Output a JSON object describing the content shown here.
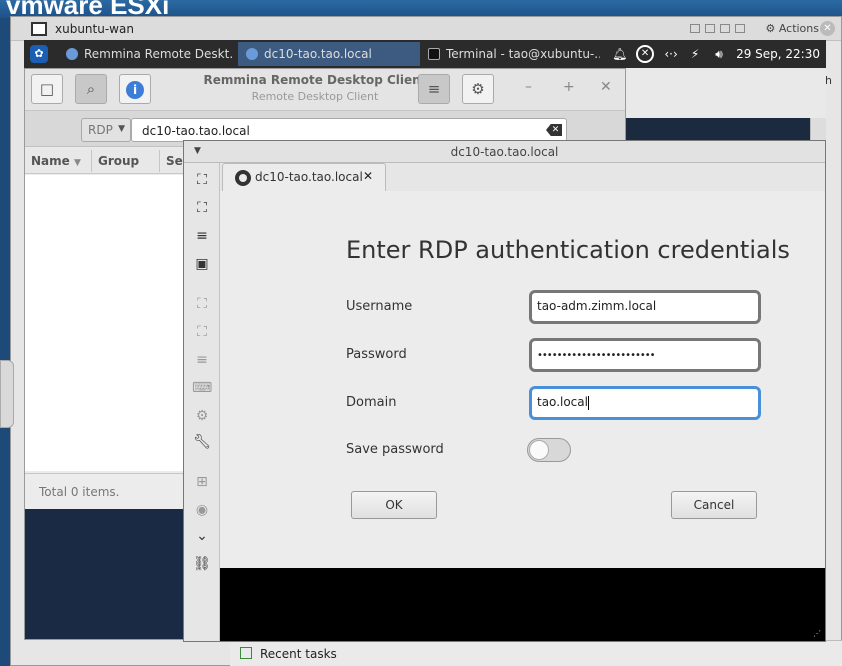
{
  "esxi": {
    "logo": "vmware ESXi",
    "vm_title": "xubuntu-wan",
    "actions_label": "Actions",
    "recent_tasks": "Recent tasks"
  },
  "panel": {
    "tasks": [
      {
        "label": "Remmina Remote Deskt...",
        "active": false
      },
      {
        "label": "dc10-tao.tao.local",
        "active": true
      },
      {
        "label": "Terminal - tao@xubuntu-...",
        "active": false
      }
    ],
    "clock": "29 Sep, 22:30"
  },
  "terminal_glimpse": "h",
  "remmina": {
    "title": "Remmina Remote Desktop Client",
    "subtitle": "Remote Desktop Client",
    "protocol": "RDP",
    "search_value": "dc10-tao.tao.local",
    "columns": [
      "Name",
      "Group",
      "Ser"
    ],
    "status": "Total 0 items."
  },
  "connection": {
    "window_title": "dc10-tao.tao.local",
    "tab_label": "dc10-tao.tao.local",
    "dialog": {
      "heading": "Enter RDP authentication credentials",
      "username_label": "Username",
      "username_value": "tao-adm.zimm.local",
      "password_label": "Password",
      "password_value": "••••••••••••••••••••••••",
      "domain_label": "Domain",
      "domain_value": "tao.local",
      "save_password_label": "Save password",
      "save_password_on": false,
      "ok_label": "OK",
      "cancel_label": "Cancel"
    }
  },
  "colors": {
    "accent": "#4a90d9",
    "panel_active": "#3d5a80",
    "info_blue": "#3d7dd8"
  }
}
